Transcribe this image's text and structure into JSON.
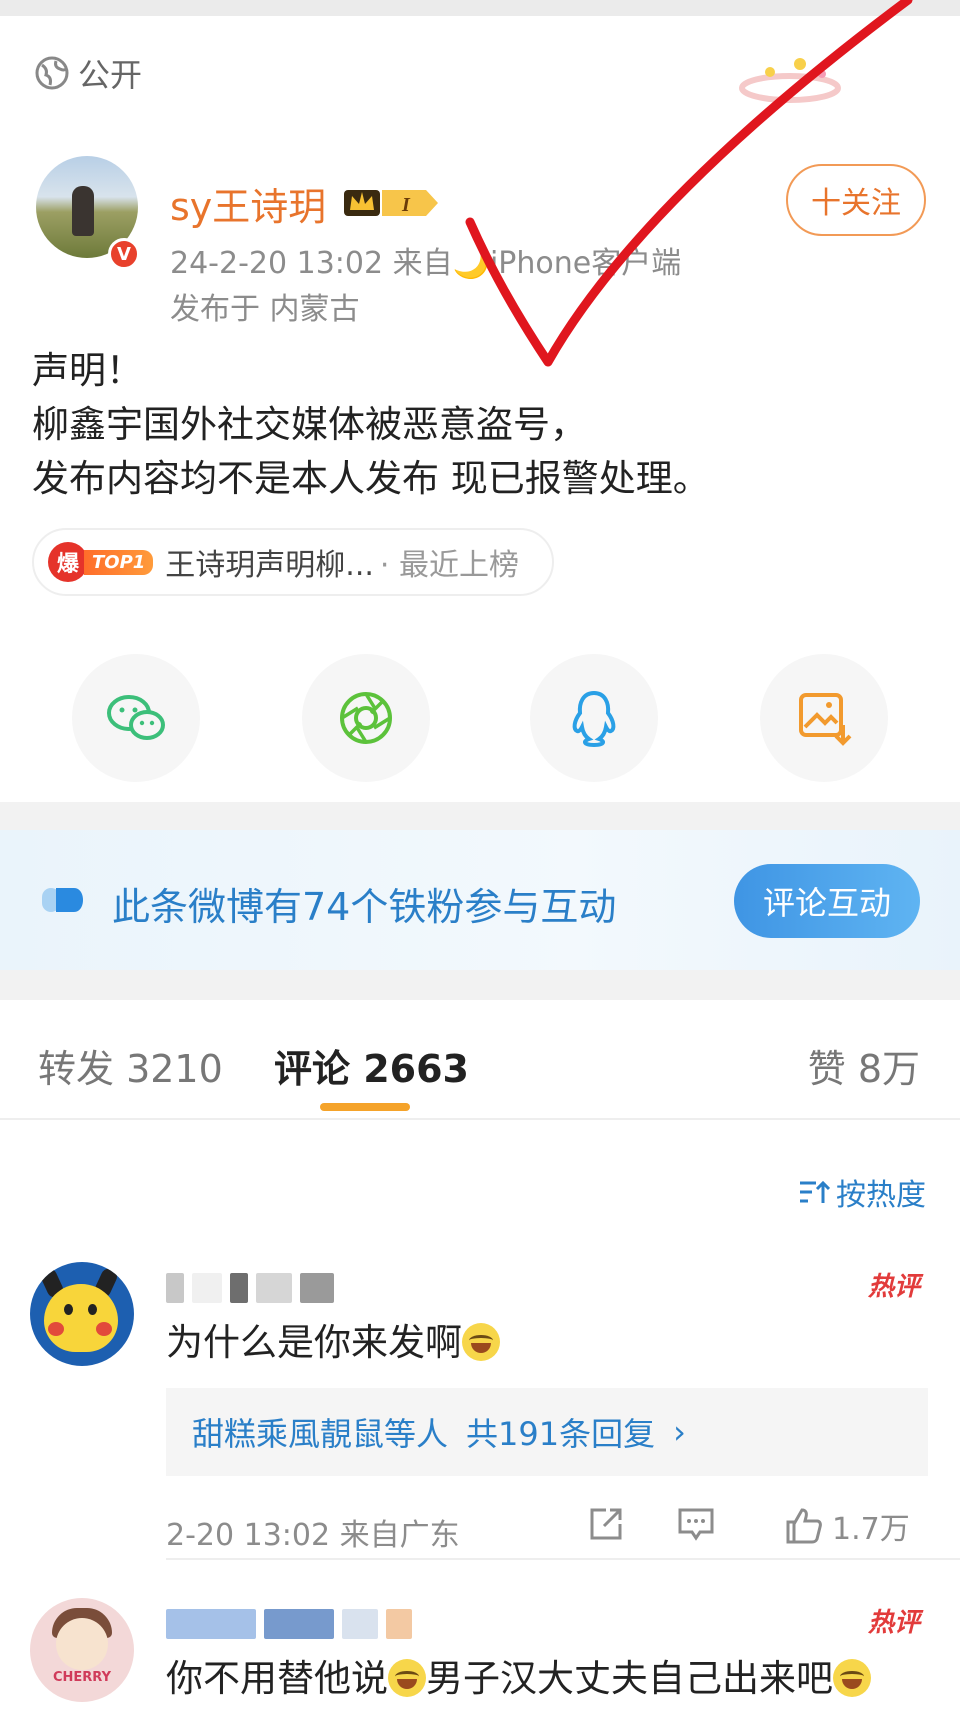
{
  "post": {
    "visibility": "公开",
    "username": "sy王诗玥",
    "level_badge": "I",
    "time_source": "24-2-20 13:02  来自🌙iPhone客户端",
    "location": "发布于 内蒙古",
    "follow_label": "十关注",
    "content_lines": [
      "声明！",
      "柳鑫宇国外社交媒体被恶意盗号，",
      "发布内容均不是本人发布 现已报警处理。"
    ],
    "hot_topic": {
      "badge": "爆",
      "rank": "TOP1",
      "title": "王诗玥声明柳...",
      "status": "· 最近上榜"
    },
    "share_icons": [
      "wechat-icon",
      "moments-icon",
      "qq-icon",
      "save-image-icon"
    ]
  },
  "fans_banner": {
    "text": "此条微博有74个铁粉参与互动",
    "button": "评论互动"
  },
  "tabs": {
    "repost": "转发 3210",
    "comment": "评论 2663",
    "like": "赞 8万"
  },
  "sort_label": "按热度",
  "comments": [
    {
      "hot_tag": "热评",
      "text": "为什么是你来发啊",
      "reply_summary": "甜糕乘風靚鼠等人",
      "reply_count": "共191条回复",
      "time_location": "2-20 13:02 来自广东",
      "likes": "1.7万"
    },
    {
      "hot_tag": "热评",
      "text_part1": "你不用替他说",
      "text_part2": "男子汉大丈夫自己出来吧",
      "avatar_label": "CHERRY"
    }
  ],
  "colors": {
    "accent_orange": "#e8742c",
    "link_blue": "#2a7fc8",
    "hot_red": "#e23b3b",
    "check_red": "#e0161e"
  }
}
